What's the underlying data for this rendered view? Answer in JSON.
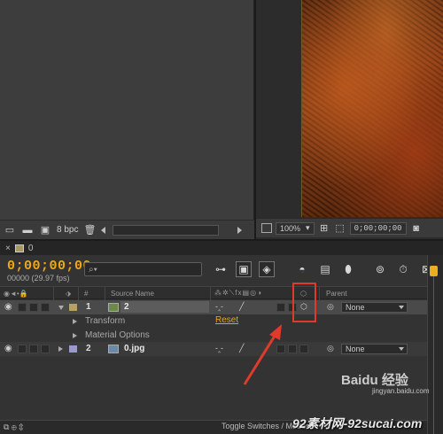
{
  "project_panel": {
    "bpc_label": "8 bpc"
  },
  "comp_viewer": {
    "zoom": "100%",
    "timecode": "0;00;00;00"
  },
  "timeline": {
    "tab_close": "×",
    "tab_label": "0",
    "current_time": "0;00;00;00",
    "fps_label": "00000 (29.97 fps)",
    "search_placeholder": "",
    "columns": {
      "number": "#",
      "source_name": "Source Name",
      "parent": "Parent"
    },
    "layers": [
      {
        "number": "1",
        "name": "2",
        "label_color": "#b8a060",
        "parent": "None",
        "expanded": true
      },
      {
        "number": "2",
        "name": "0.jpg",
        "label_color": "#9a9ad0",
        "parent": "None",
        "expanded": false
      }
    ],
    "layer1_properties": [
      {
        "name": "Transform",
        "action": "Reset"
      },
      {
        "name": "Material Options"
      }
    ],
    "toggle_label": "Toggle Switches / Modes"
  },
  "watermark": {
    "site": "92素材网-92sucai.com",
    "baidu": "Baidu 经验",
    "baidu_url": "jingyan.baidu.com"
  },
  "colors": {
    "timecode": "#f0a818",
    "highlight": "#e03a2a"
  },
  "icons": [
    "new-comp-icon",
    "folder-icon",
    "interpret-icon",
    "trash-icon",
    "search-icon",
    "eye-icon",
    "audio-icon",
    "solo-icon",
    "lock-icon",
    "label-icon",
    "3d-layer-icon",
    "parent-pickwhip-icon",
    "comp-icon",
    "image-icon",
    "stopwatch-icon"
  ]
}
